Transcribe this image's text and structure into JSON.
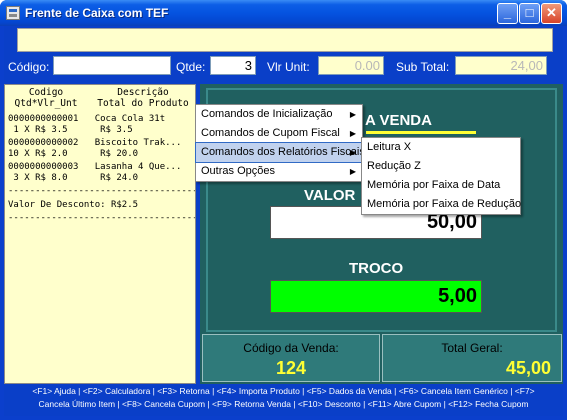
{
  "window": {
    "title": "Frente de Caixa com TEF",
    "icons": {
      "app": "app-icon",
      "minimize": "_",
      "maximize": "□",
      "close": "✕"
    }
  },
  "topbar": {
    "barcode_value": ""
  },
  "fields": {
    "codigo_label": "Código:",
    "codigo_value": "",
    "qtde_label": "Qtde:",
    "qtde_value": "3",
    "vlr_unit_label": "Vlr Unit:",
    "vlr_unit_value": "0.00",
    "sub_total_label": "Sub Total:",
    "sub_total_value": "24,00"
  },
  "receipt": {
    "header": {
      "col1_line1": "Codigo",
      "col1_line2": "Qtd*Vlr_Unt",
      "col2_line1": "Descrição",
      "col2_line2": "Total do Produto"
    },
    "rows": [
      "0000000000001   Coca Cola 31t",
      " 1 X R$ 3.5      R$ 3.5",
      "0000000000002   Biscoito Trak...",
      "10 X R$ 2.0      R$ 20.0",
      "0000000000003   Lasanha 4 Que...",
      " 3 X R$ 8.0      R$ 24.0",
      "-----------------------------------",
      "Valor De Desconto: R$2.5",
      "-----------------------------------"
    ]
  },
  "main": {
    "status": "A VENDA",
    "valor_label": "VALOR",
    "valor_value": "50,00",
    "troco_label": "TROCO",
    "troco_value": "5,00"
  },
  "bottom": {
    "codigo_venda_label": "Código da Venda:",
    "codigo_venda_value": "124",
    "total_geral_label": "Total Geral:",
    "total_geral_value": "45,00"
  },
  "shortcuts": {
    "line1": "<F1> Ajuda | <F2> Calculadora | <F3> Retorna | <F4> Importa Produto | <F5> Dados da Venda | <F6> Cancela Item Genérico | <F7>",
    "line2": "Cancela Último Item | <F8> Cancela Cupom | <F9> Retorna Venda | <F10> Desconto | <F11> Abre Cupom | <F12> Fecha Cupom"
  },
  "menu": {
    "items": [
      {
        "label": "Comandos de Inicialização",
        "arrow": "▶"
      },
      {
        "label": "Comandos de Cupom Fiscal",
        "arrow": "▶"
      },
      {
        "label": "Comandos dos Relatórios Fiscais",
        "arrow": "▶",
        "selected": true
      },
      {
        "label": "Outras Opções",
        "arrow": "▶"
      }
    ],
    "submenu": [
      {
        "label": "Leitura X"
      },
      {
        "label": "Redução Z"
      },
      {
        "label": "Memória por Faixa de Data"
      },
      {
        "label": "Memória por Faixa de Redução"
      }
    ]
  },
  "colors": {
    "title_bar": "#0553e0",
    "client_bg": "#0a3fc8",
    "yellow_field": "#ffffcc",
    "teal_panel": "#206060",
    "troco_green": "#00ff00",
    "accent_yellow": "#ffff33",
    "menu_highlight": "#c1d2ee"
  }
}
